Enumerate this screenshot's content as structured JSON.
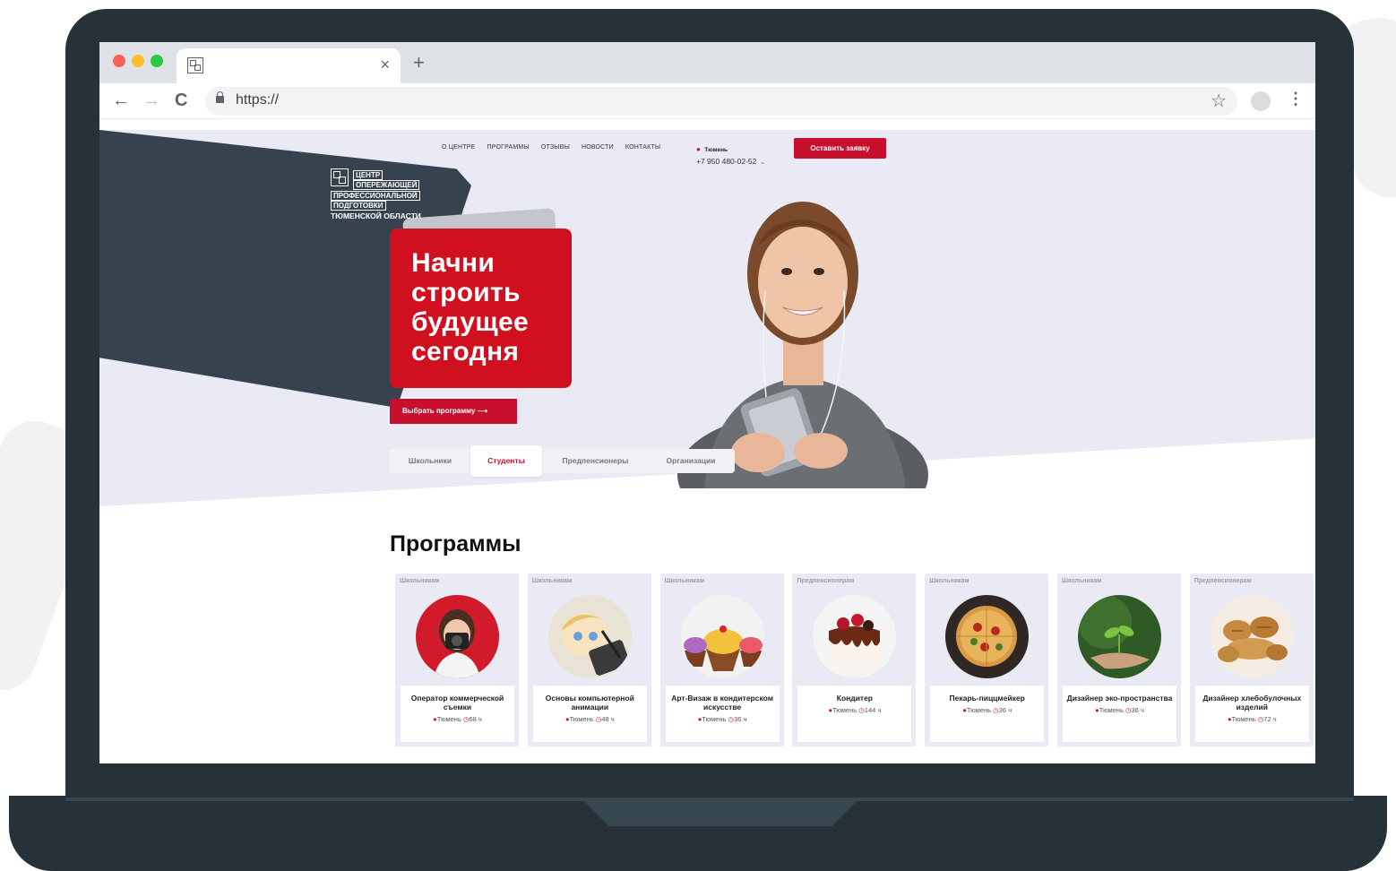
{
  "browser": {
    "url": "https://",
    "tab_close": "×",
    "new_tab": "+",
    "back": "←",
    "forward": "→",
    "reload": "C",
    "star": "☆",
    "menu": "⋮",
    "traffic_lights": [
      "#ff5f57",
      "#febc2e",
      "#28c840"
    ]
  },
  "site": {
    "logo": {
      "lines": [
        "ЦЕНТР",
        "ОПЕРЕЖАЮЩЕЙ",
        "ПРОФЕССИОНАЛЬНОЙ",
        "ПОДГОТОВКИ",
        "ТЮМЕНСКОЙ ОБЛАСТИ"
      ]
    },
    "nav": [
      "О ЦЕНТРЕ",
      "ПРОГРАММЫ",
      "ОТЗЫВЫ",
      "НОВОСТИ",
      "КОНТАКТЫ"
    ],
    "city": "Тюмень",
    "phone": "+7 950 480-02-52",
    "phone_caret": "⌄",
    "cta": "Оставить заявку",
    "headline": "Начни\nстроить\nбудущее\nсегодня",
    "choose_button": "Выбрать программу ⟶",
    "audience_tabs": [
      {
        "label": "Школьники",
        "active": false
      },
      {
        "label": "Студенты",
        "active": true
      },
      {
        "label": "Предпенсионеры",
        "active": false
      },
      {
        "label": "Организации",
        "active": false
      }
    ],
    "programs_title": "Программы",
    "accent_color": "#c8102e"
  },
  "programs": [
    {
      "tag": "Школьникам",
      "title": "Оператор коммерческой съемки",
      "city": "Тюмень",
      "hours": "68 ч",
      "image": "photographer"
    },
    {
      "tag": "Школьникам",
      "title": "Основы компьютерной анимации",
      "city": "Тюмень",
      "hours": "48 ч",
      "image": "animation"
    },
    {
      "tag": "Школьникам",
      "title": "Арт-Визаж в кондитерском искусстве",
      "city": "Тюмень",
      "hours": "36 ч",
      "image": "cupcakes"
    },
    {
      "tag": "Предпенсионерам",
      "title": "Кондитер",
      "city": "Тюмень",
      "hours": "144 ч",
      "image": "cake"
    },
    {
      "tag": "Школьникам",
      "title": "Пекарь-пиццмейкер",
      "city": "Тюмень",
      "hours": "36 ч",
      "image": "pizza"
    },
    {
      "tag": "Школьникам",
      "title": "Дизайнер эко-пространства",
      "city": "Тюмень",
      "hours": "36 ч",
      "image": "plant"
    },
    {
      "tag": "Предпенсионерам",
      "title": "Дизайнер хлебобулочных изделий",
      "city": "Тюмень",
      "hours": "72 ч",
      "image": "bread"
    }
  ]
}
